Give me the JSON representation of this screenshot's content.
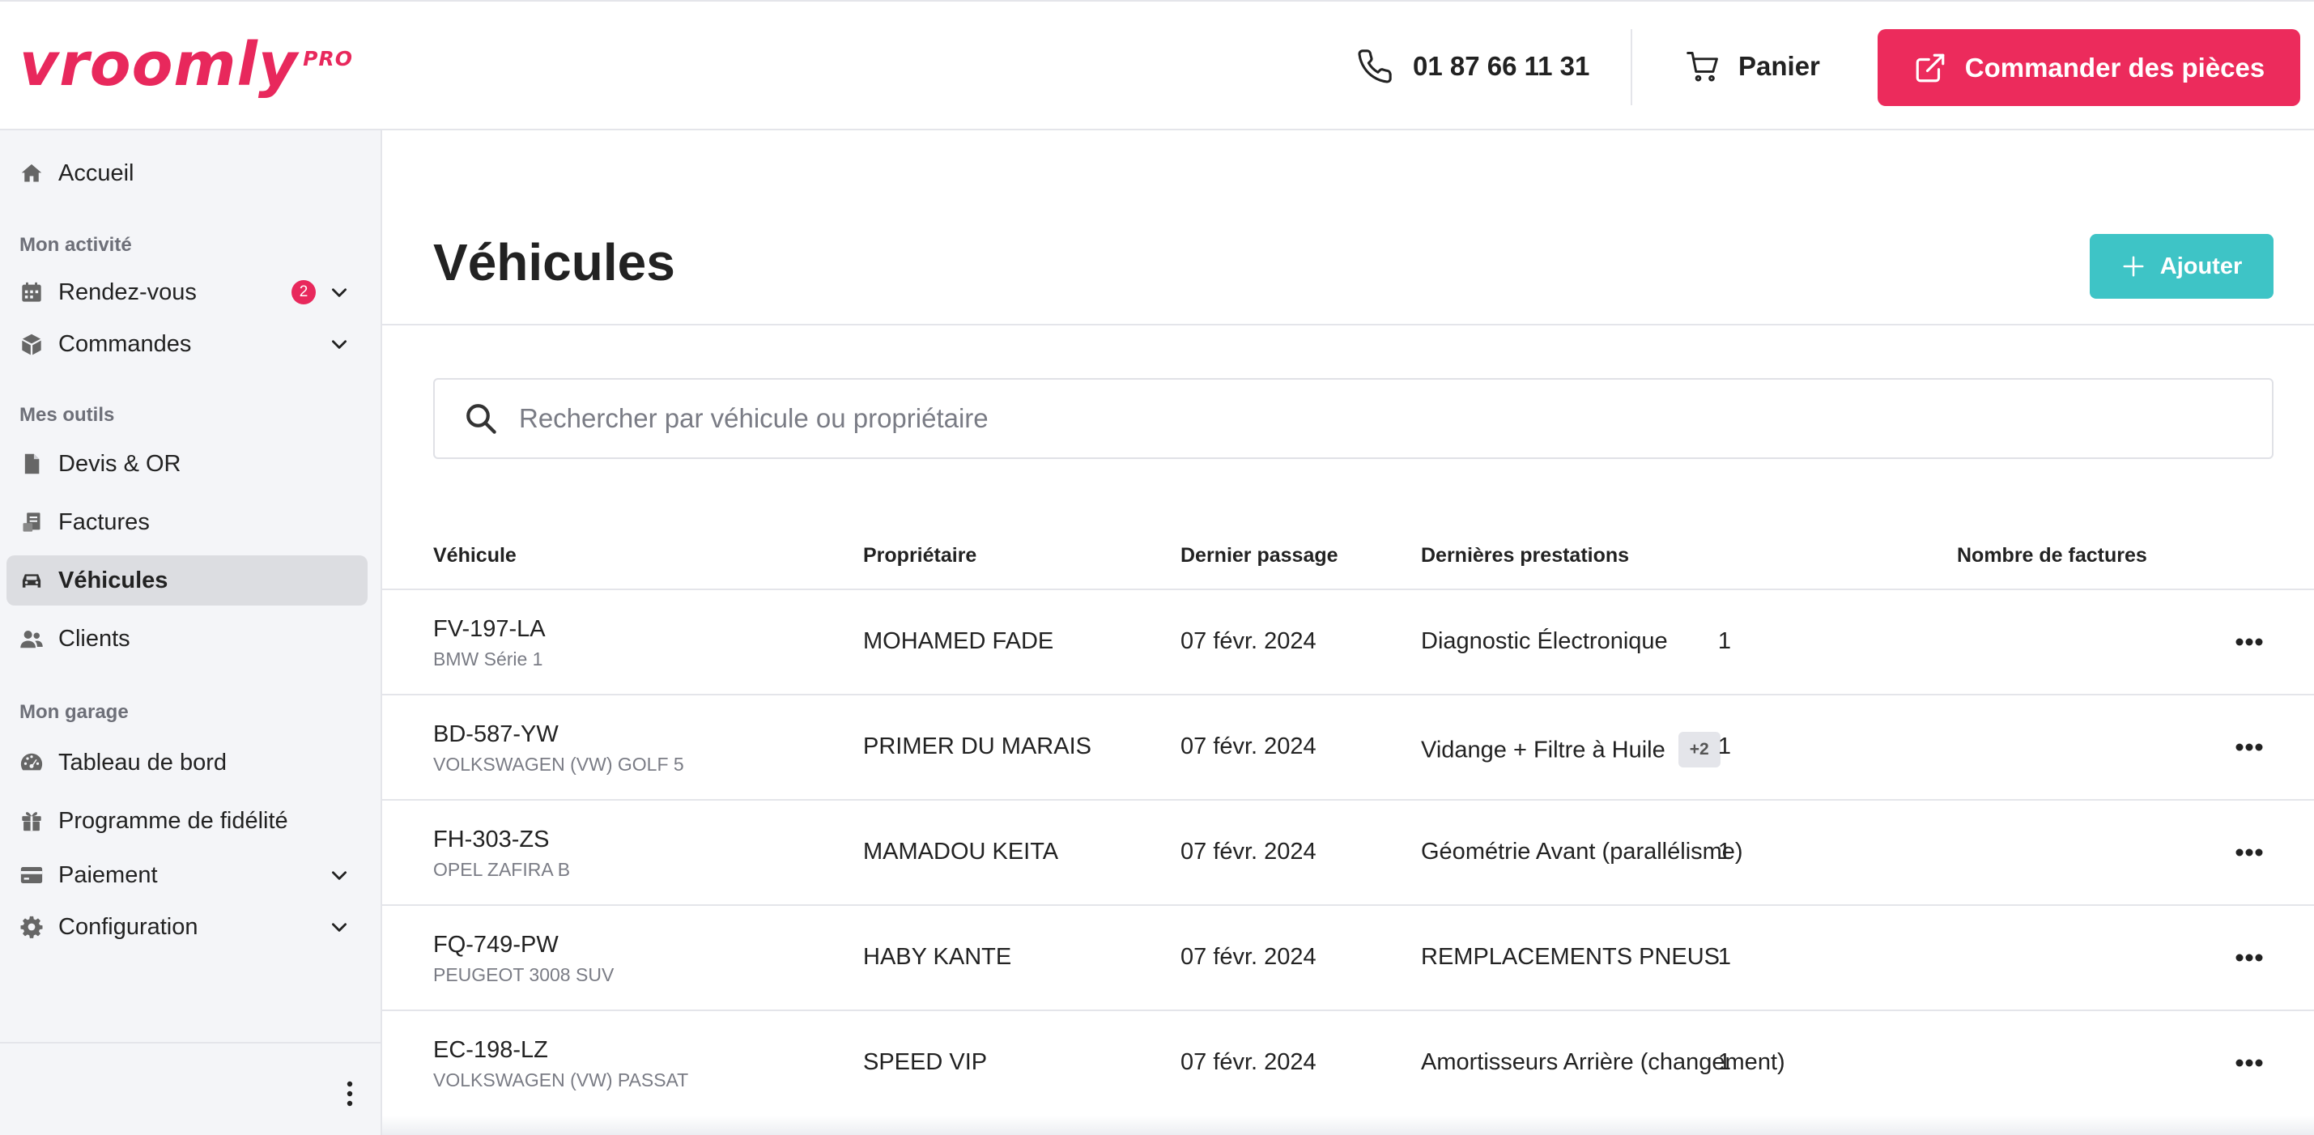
{
  "header": {
    "logo_text": "vroomly",
    "logo_suffix": "PRO",
    "phone": "01 87 66 11 31",
    "cart_label": "Panier",
    "order_button": "Commander des pièces"
  },
  "sidebar": {
    "home": "Accueil",
    "sections": {
      "activity": "Mon activité",
      "tools": "Mes outils",
      "garage": "Mon garage"
    },
    "items": {
      "appointments": {
        "label": "Rendez-vous",
        "badge": "2"
      },
      "orders": {
        "label": "Commandes"
      },
      "quotes": {
        "label": "Devis & OR"
      },
      "invoices": {
        "label": "Factures"
      },
      "vehicles": {
        "label": "Véhicules"
      },
      "clients": {
        "label": "Clients"
      },
      "dashboard": {
        "label": "Tableau de bord"
      },
      "loyalty": {
        "label": "Programme de fidélité"
      },
      "payment": {
        "label": "Paiement"
      },
      "configuration": {
        "label": "Configuration"
      }
    }
  },
  "main": {
    "title": "Véhicules",
    "add_button": "Ajouter",
    "search": {
      "placeholder": "Rechercher par véhicule ou propriétaire",
      "value": ""
    },
    "columns": {
      "vehicle": "Véhicule",
      "owner": "Propriétaire",
      "last_visit": "Dernier passage",
      "last_services": "Dernières prestations",
      "invoice_count": "Nombre de factures"
    },
    "rows": [
      {
        "plate": "FV-197-LA",
        "model": "BMW Série 1",
        "owner": "MOHAMED FADE",
        "date": "07 févr. 2024",
        "service": "Diagnostic Électronique",
        "extra": "",
        "count": "1"
      },
      {
        "plate": "BD-587-YW",
        "model": "VOLKSWAGEN (VW) GOLF 5",
        "owner": "PRIMER DU MARAIS",
        "date": "07 févr. 2024",
        "service": "Vidange + Filtre à Huile",
        "extra": "+2",
        "count": "1"
      },
      {
        "plate": "FH-303-ZS",
        "model": "OPEL ZAFIRA B",
        "owner": "MAMADOU KEITA",
        "date": "07 févr. 2024",
        "service": "Géométrie Avant (parallélisme)",
        "extra": "",
        "count": "1"
      },
      {
        "plate": "FQ-749-PW",
        "model": "PEUGEOT 3008 SUV",
        "owner": "HABY KANTE",
        "date": "07 févr. 2024",
        "service": "REMPLACEMENTS PNEUS",
        "extra": "",
        "count": "1"
      },
      {
        "plate": "EC-198-LZ",
        "model": "VOLKSWAGEN (VW) PASSAT",
        "owner": "SPEED VIP",
        "date": "07 févr. 2024",
        "service": "Amortisseurs Arrière (changement)",
        "extra": "",
        "count": "1"
      }
    ]
  },
  "colors": {
    "brand": "#e8285c",
    "order_button": "#ec2b5c",
    "add_button": "#3ec4c6",
    "sidebar_bg": "#f4f5f8",
    "active_item_bg": "#dcdde1"
  },
  "icons": {
    "header": [
      "phone-icon",
      "cart-icon",
      "external-link-icon"
    ],
    "sidebar": [
      "home-icon",
      "calendar-icon",
      "cube-icon",
      "file-icon",
      "invoice-icon",
      "car-icon",
      "users-icon",
      "gauge-icon",
      "gift-icon",
      "credit-card-icon",
      "gear-icon",
      "chevron-down-icon",
      "vertical-dots-icon"
    ],
    "main": [
      "plus-icon",
      "search-icon",
      "more-horizontal-icon"
    ]
  }
}
